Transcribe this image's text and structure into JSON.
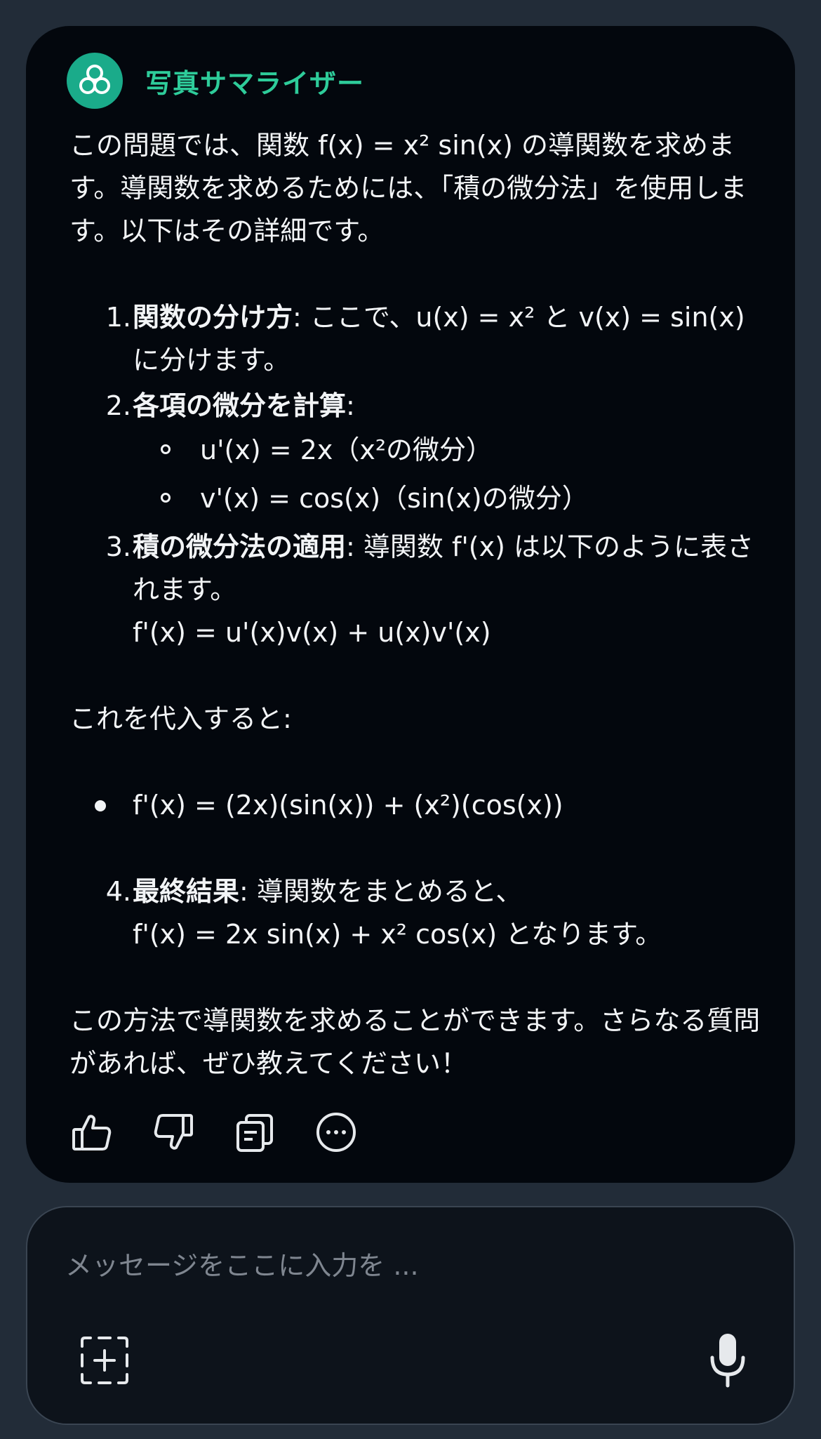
{
  "app": {
    "title": "写真サマライザー",
    "accent_color": "#1aab8a"
  },
  "message": {
    "intro": "この問題では、関数 f(x) = x² sin(x) の導関数を求めます。導関数を求めるためには、「積の微分法」を使用します。以下はその詳細です。",
    "steps": [
      {
        "num": "1.",
        "title": "関数の分け方",
        "text": ": ここで、u(x) = x² と v(x) = sin(x) に分けます。"
      },
      {
        "num": "2.",
        "title": "各項の微分を計算",
        "text": ":",
        "sub": [
          "u'(x) = 2x（x²の微分）",
          "v'(x) = cos(x)（sin(x)の微分）"
        ]
      },
      {
        "num": "3.",
        "title": "積の微分法の適用",
        "text": ": 導関数 f'(x) は以下のように表されます。",
        "formula": "f'(x) = u'(x)v(x) + u(x)v'(x)"
      }
    ],
    "substitution_text": "これを代入すると:",
    "substitution_bullet": "f'(x) = (2x)(sin(x)) + (x²)(cos(x))",
    "final_step": {
      "num": "4.",
      "title": "最終結果",
      "text": ": 導関数をまとめると、",
      "formula": "f'(x) = 2x sin(x) + x² cos(x) となります。"
    },
    "outro": "この方法で導関数を求めることができます。さらなる質問があれば、ぜひ教えてください！"
  },
  "actions": [
    "thumbs-up-icon",
    "thumbs-down-icon",
    "copy-icon",
    "more-icon"
  ],
  "composer": {
    "placeholder": "メッセージをここに入力を ...",
    "attach_icon": "add-image-icon",
    "mic_icon": "microphone-icon"
  }
}
